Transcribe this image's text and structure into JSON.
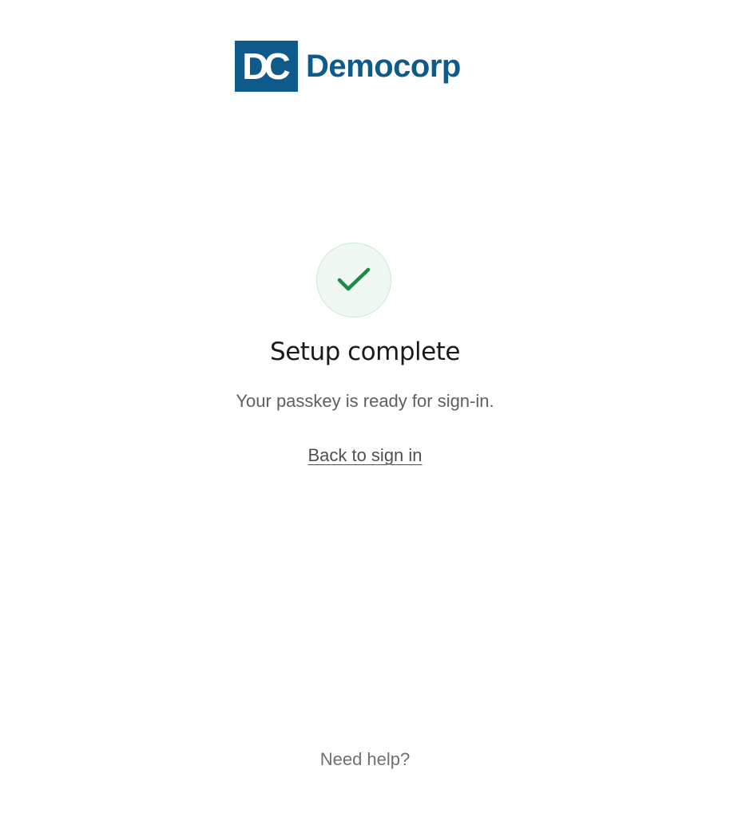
{
  "brand": {
    "logo_mark_text": "DC",
    "logo_text": "Democorp",
    "color": "#0e5a8a"
  },
  "status": {
    "icon": "check-icon",
    "icon_color": "#1f8a44",
    "title": "Setup complete",
    "message": "Your passkey is ready for sign-in."
  },
  "actions": {
    "back_to_sign_in": "Back to sign in",
    "need_help": "Need help?"
  }
}
